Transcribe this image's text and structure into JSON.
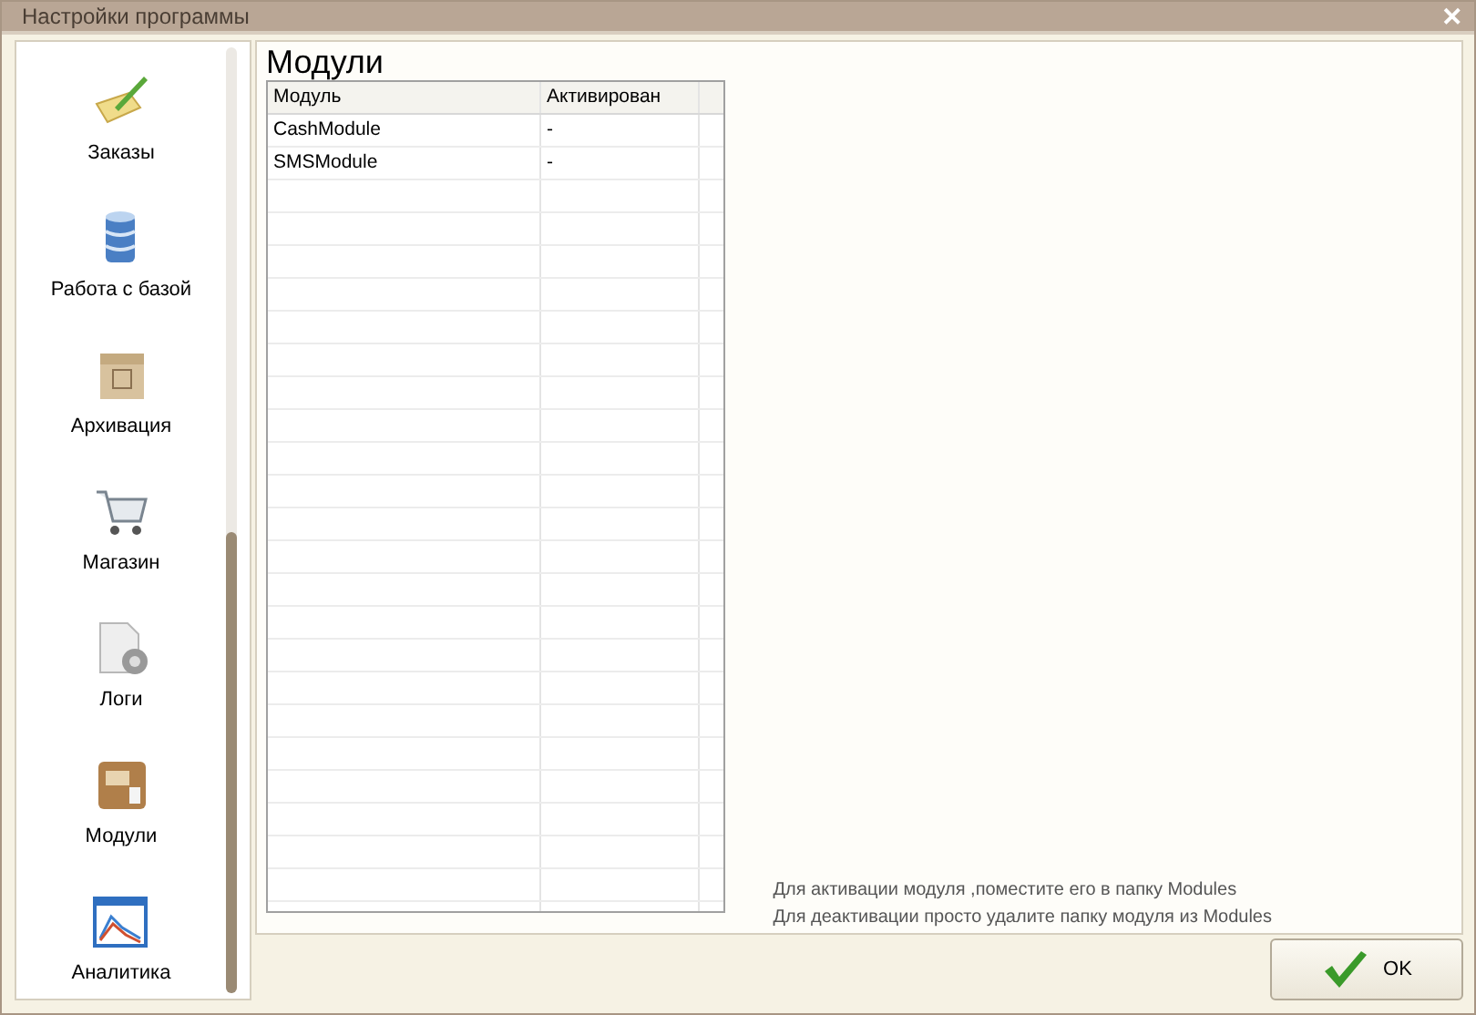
{
  "window": {
    "title": "Настройки программы",
    "close": "✕"
  },
  "sidebar": {
    "items": [
      {
        "label": "Заказы"
      },
      {
        "label": "Работа с базой"
      },
      {
        "label": "Архивация"
      },
      {
        "label": "Магазин"
      },
      {
        "label": "Логи"
      },
      {
        "label": "Модули"
      },
      {
        "label": "Аналитика"
      }
    ]
  },
  "section_title": "Модули",
  "table": {
    "columns": [
      "Модуль",
      "Активирован"
    ],
    "rows": [
      [
        "CashModule",
        "-"
      ],
      [
        "SMSModule",
        "-"
      ]
    ]
  },
  "hints": [
    "Для активации модуля ,поместите его в папку Modules",
    "Для деактивации просто удалите папку модуля из Modules"
  ],
  "ok_button": "OK"
}
